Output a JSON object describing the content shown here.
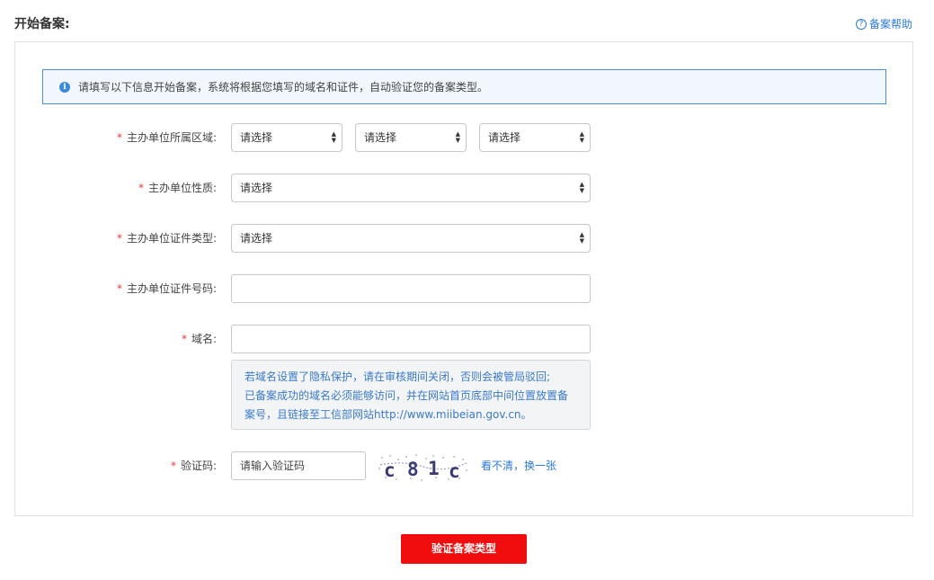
{
  "header": {
    "title": "开始备案:",
    "help_label": "备案帮助",
    "help_icon": "question-circle-icon"
  },
  "notice": {
    "icon": "info-icon",
    "text": "请填写以下信息开始备案，系统将根据您填写的域名和证件，自动验证您的备案类型。"
  },
  "form": {
    "required_mark": "*",
    "region": {
      "label": "主办单位所属区域:",
      "province": "请选择",
      "city": "请选择",
      "district": "请选择"
    },
    "nature": {
      "label": "主办单位性质:",
      "value": "请选择"
    },
    "cert_type": {
      "label": "主办单位证件类型:",
      "value": "请选择"
    },
    "cert_number": {
      "label": "主办单位证件号码:",
      "value": ""
    },
    "domain": {
      "label": "域名:",
      "value": "",
      "tip_line1": "若域名设置了隐私保护，请在审核期间关闭，否则会被管局驳回;",
      "tip_line2": "已备案成功的域名必须能够访问，并在网站首页底部中间位置放置备案号，且链接至工信部网站http://www.miibeian.gov.cn。"
    },
    "captcha": {
      "label": "验证码:",
      "placeholder": "请输入验证码",
      "code": "c81c",
      "refresh_label": "看不清，换一张"
    }
  },
  "submit": {
    "label": "验证备案类型",
    "color": "#f10d0d"
  },
  "colors": {
    "link": "#2d7bd6",
    "required": "#e4393c",
    "notice_border": "#4d8fd6"
  }
}
